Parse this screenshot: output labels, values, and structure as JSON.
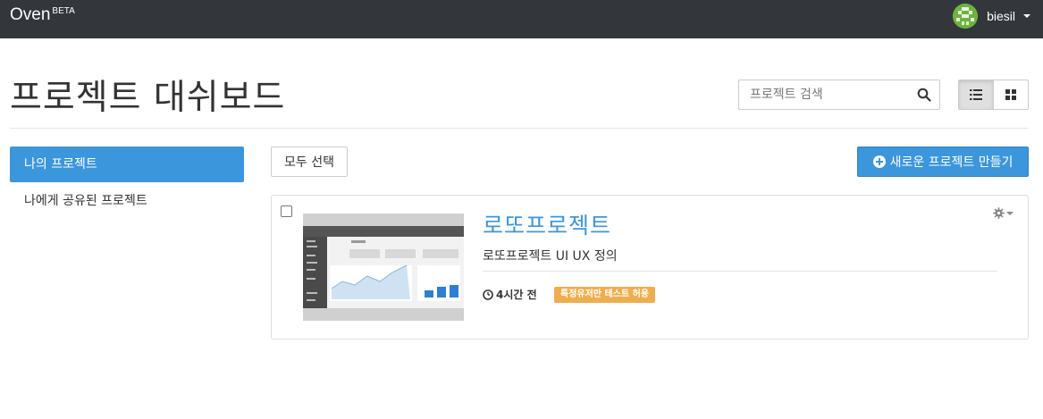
{
  "navbar": {
    "brand": "Oven",
    "brand_tag": "BETA",
    "username": "biesil"
  },
  "header": {
    "title": "프로젝트 대쉬보드",
    "search_placeholder": "프로젝트 검색"
  },
  "sidebar": {
    "items": [
      {
        "label": "나의 프로젝트",
        "active": true
      },
      {
        "label": "나에게 공유된 프로젝트",
        "active": false
      }
    ]
  },
  "toolbar": {
    "select_all_label": "모두 선택",
    "new_project_label": "새로운 프로젝트 만들기"
  },
  "projects": [
    {
      "title": "로또프로젝트",
      "description": "로또프로젝트 UI UX 정의",
      "updated": "4시간 전",
      "badge": "특정유저만 테스트 허용",
      "badge_color": "#f0ad4e"
    }
  ],
  "colors": {
    "navbar": "#33373b",
    "primary": "#3c96dc",
    "badge": "#f0ad4e"
  },
  "icons": {
    "search": "search-icon",
    "list_view": "list-view-icon",
    "grid_view": "grid-view-icon",
    "clock": "clock-icon",
    "gear": "gear-icon",
    "plus": "plus-circle-icon"
  }
}
